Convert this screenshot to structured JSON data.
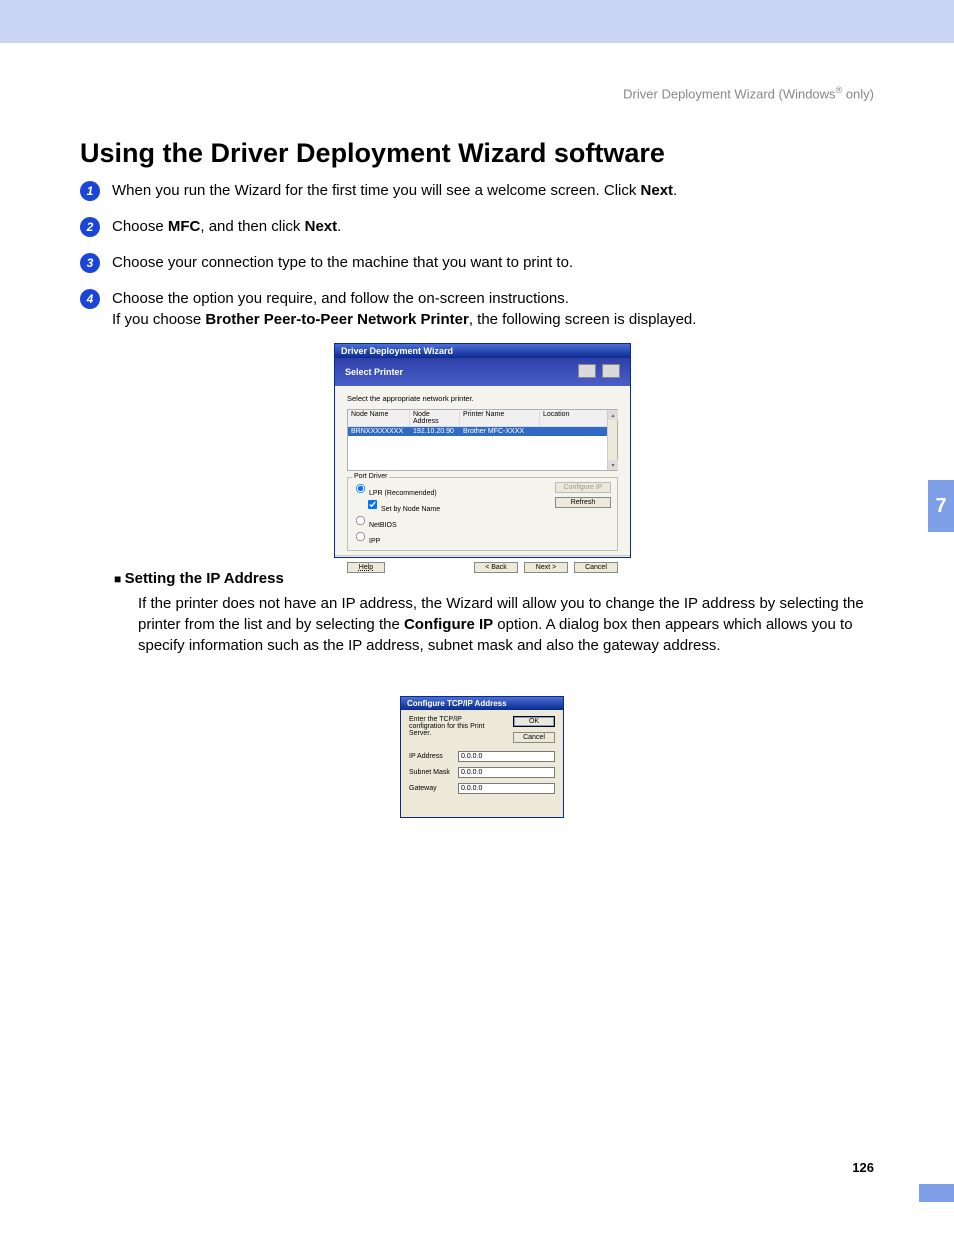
{
  "header": {
    "breadcrumb_prefix": "Driver Deployment Wizard (Windows",
    "breadcrumb_suffix": " only)"
  },
  "title": "Using the Driver Deployment Wizard software",
  "steps": [
    {
      "pre": "When you run the Wizard for the first time you will see a welcome screen. Click ",
      "bold1": "Next",
      "post1": "."
    },
    {
      "pre": "Choose ",
      "bold1": "MFC",
      "mid": ", and then click ",
      "bold2": "Next",
      "post": "."
    },
    {
      "pre": "Choose your connection type to the machine that you want to print to."
    },
    {
      "pre": "Choose the option you require, and follow the on-screen instructions.",
      "line2_pre": "If you choose ",
      "line2_bold": "Brother Peer-to-Peer Network Printer",
      "line2_post": ", the following screen is displayed."
    }
  ],
  "wizard": {
    "title": "Driver Deployment Wizard",
    "subtitle": "Select Printer",
    "hint": "Select the appropriate network printer.",
    "columns": {
      "node": "Node Name",
      "addr": "Node Address",
      "pname": "Printer Name",
      "loc": "Location"
    },
    "row": {
      "node": "BRNXXXXXXXX",
      "addr": "192.10.20.90",
      "pname": "Brother   MFC-XXXX",
      "loc": ""
    },
    "port_legend": "Port Driver",
    "port": {
      "lpr": "LPR (Recommended)",
      "setby": "Set by Node Name",
      "netbios": "NetBIOS",
      "ipp": "IPP"
    },
    "buttons": {
      "configure": "Configure IP",
      "refresh": "Refresh",
      "help": "Help",
      "back": "< Back",
      "next": "Next >",
      "cancel": "Cancel"
    }
  },
  "subsection": {
    "heading": "Setting the IP Address",
    "body_pre": "If the printer does not have an IP address, the Wizard will allow you to change the IP address by selecting the printer from the list and by selecting the ",
    "body_bold": "Configure IP",
    "body_post": " option. A dialog box then appears which allows you to specify information such as the IP address, subnet mask and also the gateway address."
  },
  "ip_dialog": {
    "title": "Configure TCP/IP Address",
    "hint": "Enter the TCP/IP configration for this Print Server.",
    "ok": "OK",
    "cancel": "Cancel",
    "fields": {
      "ip_label": "IP Address",
      "ip_value": "0.0.0.0",
      "subnet_label": "Subnet Mask",
      "subnet_value": "0.0.0.0",
      "gateway_label": "Gateway",
      "gateway_value": "0.0.0.0"
    }
  },
  "chapter": "7",
  "page_number": "126"
}
